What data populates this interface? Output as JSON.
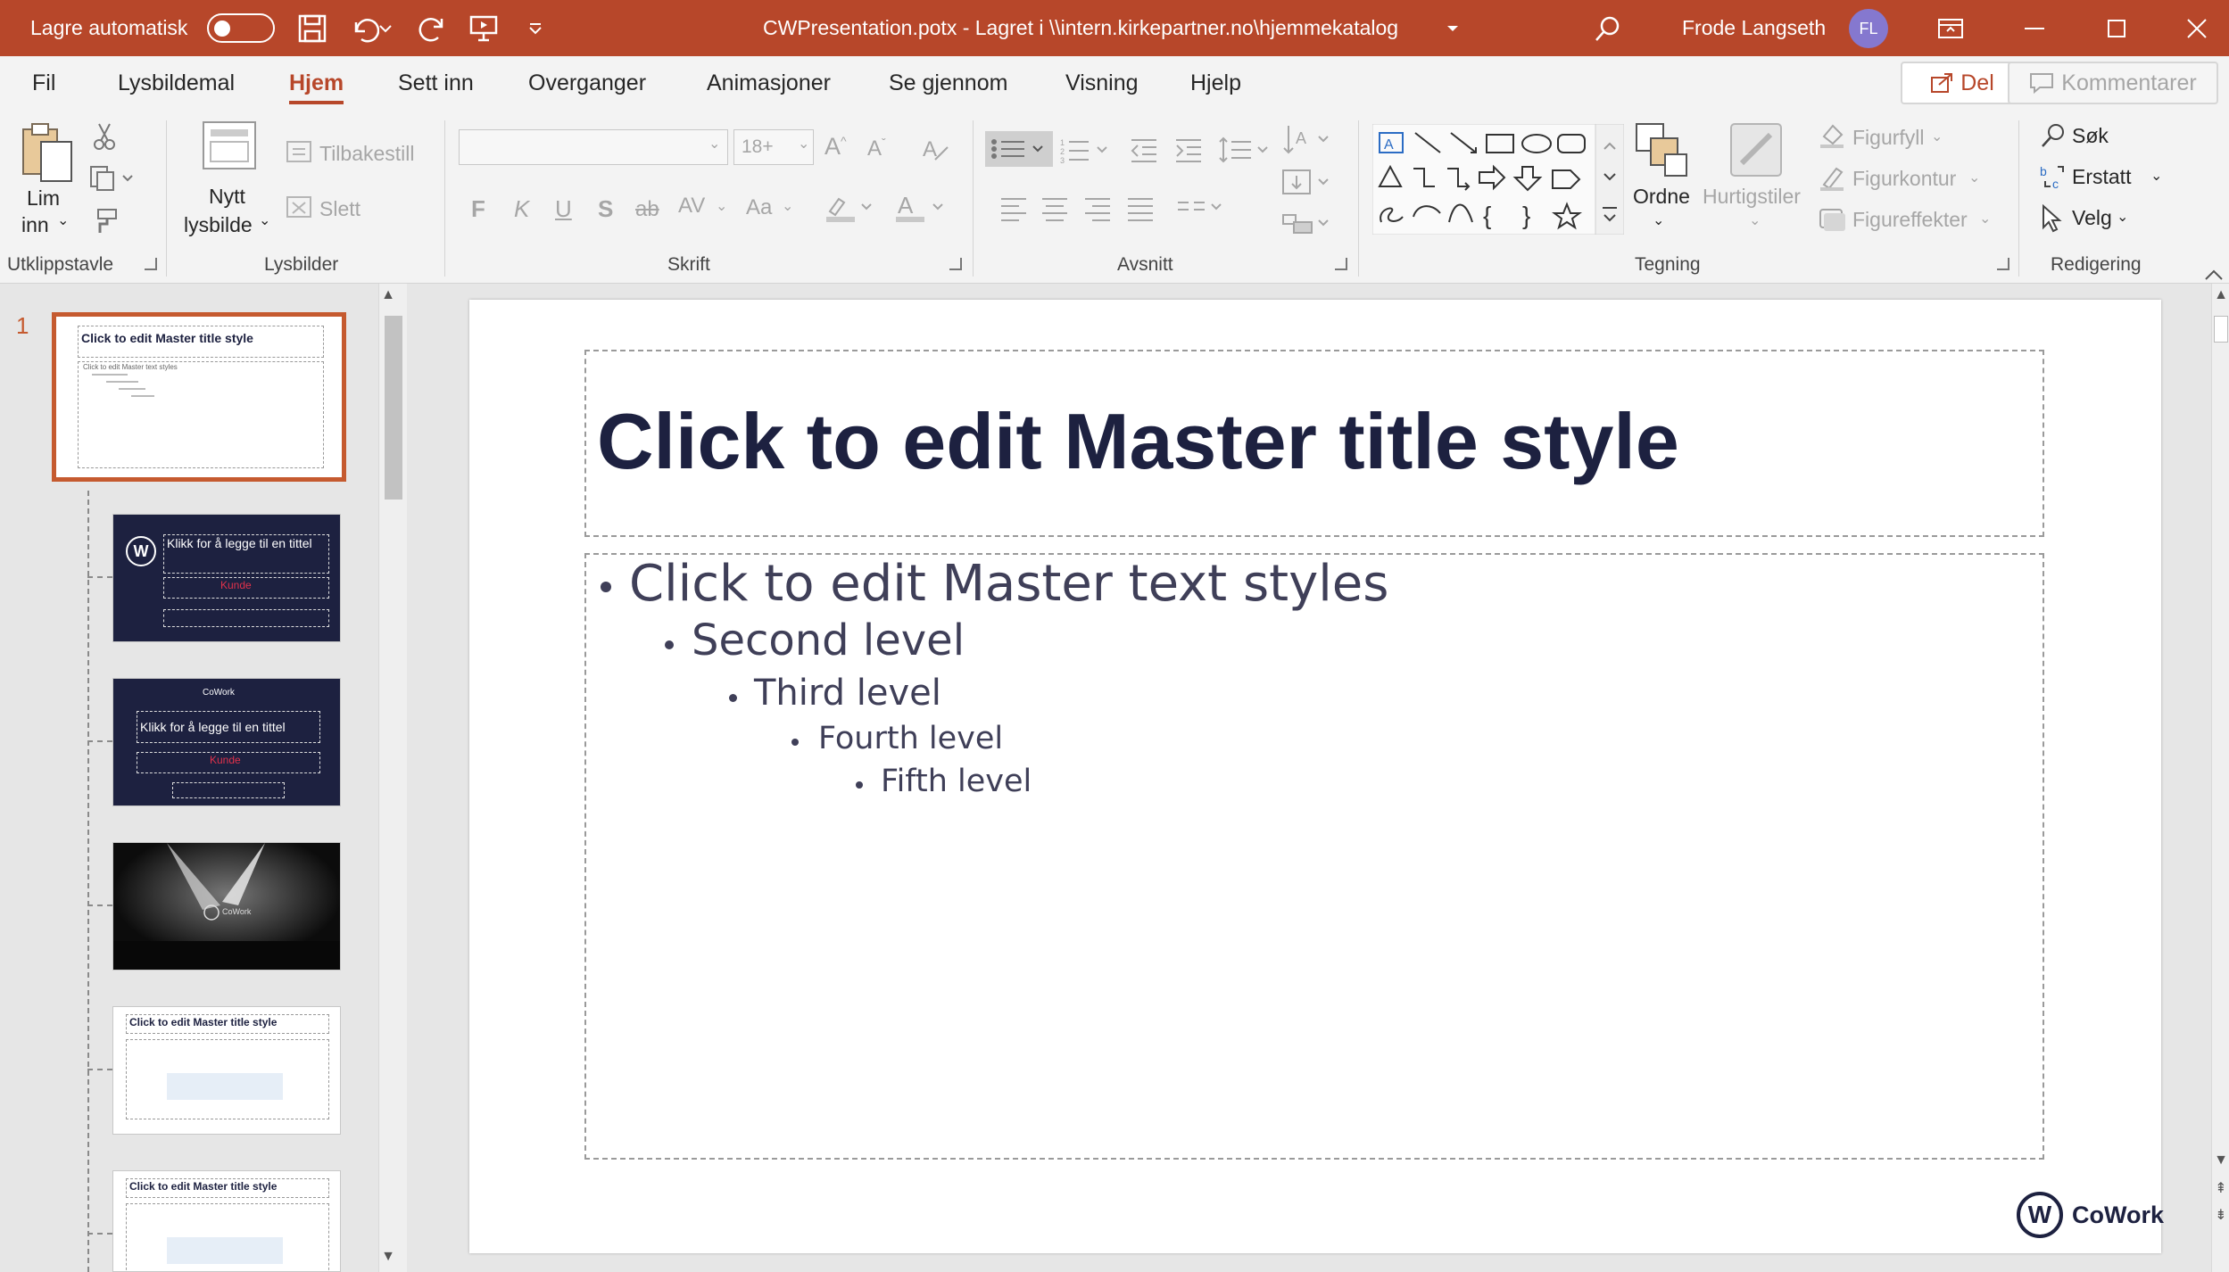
{
  "titlebar": {
    "autosave_label": "Lagre automatisk",
    "document_title": "CWPresentation.potx  -  Lagret i \\\\intern.kirkepartner.no\\hjemmekatalog",
    "user_name": "Frode Langseth",
    "user_initials": "FL",
    "bg_color": "#b7472a"
  },
  "tabs": [
    {
      "label": "Fil"
    },
    {
      "label": "Lysbildemal"
    },
    {
      "label": "Hjem"
    },
    {
      "label": "Sett inn"
    },
    {
      "label": "Overganger"
    },
    {
      "label": "Animasjoner"
    },
    {
      "label": "Se gjennom"
    },
    {
      "label": "Visning"
    },
    {
      "label": "Hjelp"
    }
  ],
  "active_tab": "Hjem",
  "share": {
    "del_label": "Del",
    "comments_label": "Kommentarer"
  },
  "ribbon": {
    "clipboard": {
      "paste_label_1": "Lim",
      "paste_label_2": "inn",
      "group_label": "Utklippstavle"
    },
    "slides": {
      "new_label_1": "Nytt",
      "new_label_2": "lysbilde",
      "reset_label": "Tilbakestill",
      "delete_label": "Slett",
      "group_label": "Lysbilder"
    },
    "font": {
      "font_name": "",
      "font_size": "18+",
      "bold": "F",
      "italic": "K",
      "underline": "U",
      "shadow": "S",
      "strike": "ab",
      "spacing": "AV",
      "case": "Aa",
      "group_label": "Skrift"
    },
    "paragraph": {
      "group_label": "Avsnitt"
    },
    "drawing": {
      "arrange_label": "Ordne",
      "quickstyles_label": "Hurtigstiler",
      "fill_label": "Figurfyll",
      "outline_label": "Figurkontur",
      "effects_label": "Figureffekter",
      "group_label": "Tegning"
    },
    "editing": {
      "find_label": "Søk",
      "replace_label": "Erstatt",
      "select_label": "Velg",
      "group_label": "Redigering"
    }
  },
  "slide_panel": {
    "selected_slide_number": "1",
    "thumbnails": [
      {
        "title": "Click to edit Master title style",
        "body": "Click to edit Master text styles"
      },
      {
        "title": "Klikk for å legge til en tittel",
        "subtitle": "Kunde"
      },
      {
        "title": "Klikk for å legge til en tittel",
        "subtitle": "Kunde",
        "logo": "CoWork"
      },
      {
        "logo": "CoWork"
      },
      {
        "title": "Click to edit Master title style"
      },
      {
        "title": "Click to edit Master title style"
      }
    ]
  },
  "slide": {
    "title": "Click to edit Master title style",
    "levels": [
      "Click to edit Master text styles",
      "Second level",
      "Third level",
      "Fourth level",
      "Fifth level"
    ],
    "logo_text": "CoWork",
    "logo_letter": "W",
    "title_color": "#1d2140"
  }
}
